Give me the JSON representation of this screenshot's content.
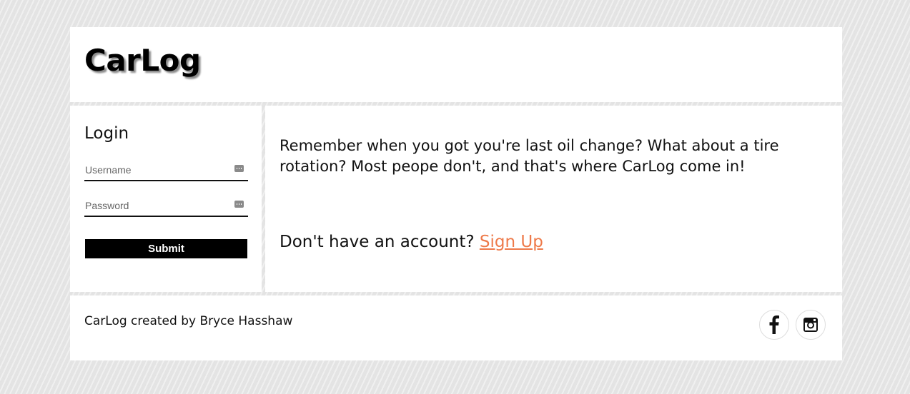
{
  "header": {
    "logo": "CarLog"
  },
  "login": {
    "title": "Login",
    "username_placeholder": "Username",
    "username_value": "",
    "password_placeholder": "Password",
    "password_value": "",
    "submit_label": "Submit"
  },
  "main": {
    "intro": "Remember when you got you're last oil change? What about a tire rotation? Most peope don't, and that's where CarLog come in!",
    "signup_prompt": "Don't have an account? ",
    "signup_link": "Sign Up",
    "link_color": "#ee7a4a"
  },
  "footer": {
    "credit": "CarLog created by Bryce Hasshaw",
    "social": [
      "facebook-icon",
      "instagram-icon"
    ]
  }
}
